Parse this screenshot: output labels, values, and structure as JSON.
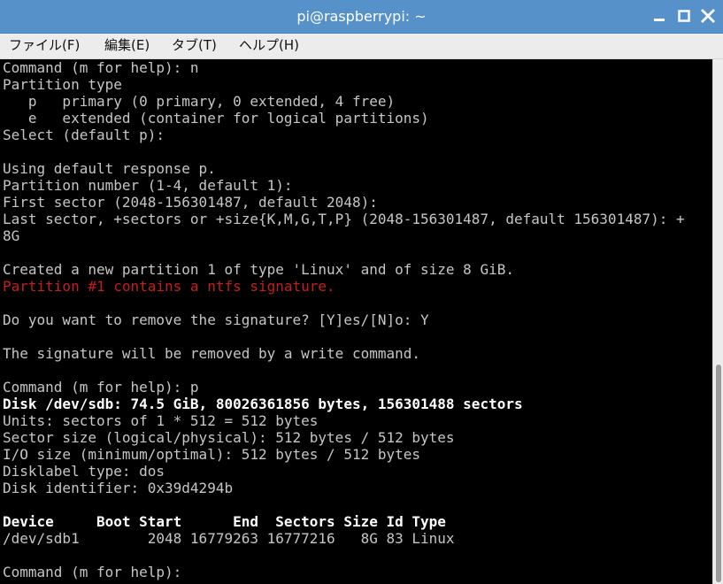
{
  "window": {
    "title": "pi@raspberrypi: ~"
  },
  "menu": [
    {
      "label": "ファイル(F)"
    },
    {
      "label": "編集(E)"
    },
    {
      "label": "タブ(T)"
    },
    {
      "label": "ヘルプ(H)"
    }
  ],
  "terminal": {
    "lines": [
      {
        "text": "Command (m for help): n",
        "style": "normal"
      },
      {
        "text": "Partition type",
        "style": "normal"
      },
      {
        "text": "   p   primary (0 primary, 0 extended, 4 free)",
        "style": "normal"
      },
      {
        "text": "   e   extended (container for logical partitions)",
        "style": "normal"
      },
      {
        "text": "Select (default p):",
        "style": "normal"
      },
      {
        "text": "",
        "style": "normal"
      },
      {
        "text": "Using default response p.",
        "style": "normal"
      },
      {
        "text": "Partition number (1-4, default 1):",
        "style": "normal"
      },
      {
        "text": "First sector (2048-156301487, default 2048):",
        "style": "normal"
      },
      {
        "text": "Last sector, +sectors or +size{K,M,G,T,P} (2048-156301487, default 156301487): +",
        "style": "normal"
      },
      {
        "text": "8G",
        "style": "normal"
      },
      {
        "text": "",
        "style": "normal"
      },
      {
        "text": "Created a new partition 1 of type 'Linux' and of size 8 GiB.",
        "style": "normal"
      },
      {
        "text": "Partition #1 contains a ntfs signature.",
        "style": "red"
      },
      {
        "text": "",
        "style": "normal"
      },
      {
        "text": "Do you want to remove the signature? [Y]es/[N]o: Y",
        "style": "normal"
      },
      {
        "text": "",
        "style": "normal"
      },
      {
        "text": "The signature will be removed by a write command.",
        "style": "normal"
      },
      {
        "text": "",
        "style": "normal"
      },
      {
        "text": "Command (m for help): p",
        "style": "normal"
      },
      {
        "text": "Disk /dev/sdb: 74.5 GiB, 80026361856 bytes, 156301488 sectors",
        "style": "bold"
      },
      {
        "text": "Units: sectors of 1 * 512 = 512 bytes",
        "style": "normal"
      },
      {
        "text": "Sector size (logical/physical): 512 bytes / 512 bytes",
        "style": "normal"
      },
      {
        "text": "I/O size (minimum/optimal): 512 bytes / 512 bytes",
        "style": "normal"
      },
      {
        "text": "Disklabel type: dos",
        "style": "normal"
      },
      {
        "text": "Disk identifier: 0x39d4294b",
        "style": "normal"
      },
      {
        "text": "",
        "style": "normal"
      },
      {
        "text": "Device     Boot Start      End  Sectors Size Id Type",
        "style": "bold"
      },
      {
        "text": "/dev/sdb1        2048 16779263 16777216   8G 83 Linux",
        "style": "normal"
      },
      {
        "text": "",
        "style": "normal"
      },
      {
        "text": "Command (m for help): ",
        "style": "normal"
      }
    ]
  },
  "colors": {
    "titlebar": "#5691c9",
    "terminal_bg": "#000000",
    "terminal_fg": "#c6c6c6",
    "error": "#c51e1e"
  },
  "icons": {
    "minimize": "minimize-icon",
    "maximize": "maximize-icon",
    "close": "close-icon"
  }
}
